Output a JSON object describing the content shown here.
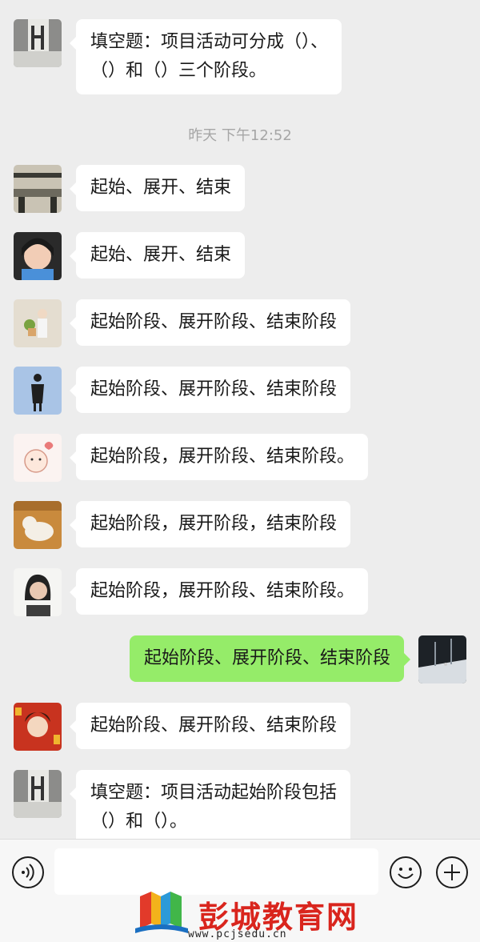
{
  "chat": {
    "timestamp": "昨天 下午12:52",
    "messages": [
      {
        "side": "left",
        "avatar": "avatar-statue",
        "text": "填空题：项目活动可分成（）、\n（）和（）三个阶段。"
      },
      {
        "side": "left",
        "avatar": "avatar-building",
        "text": "起始、展开、结束"
      },
      {
        "side": "left",
        "avatar": "avatar-girl",
        "text": "起始、展开、结束"
      },
      {
        "side": "left",
        "avatar": "avatar-illustration-plant",
        "text": "起始阶段、展开阶段、结束阶段"
      },
      {
        "side": "left",
        "avatar": "avatar-illustration-figure",
        "text": "起始阶段、展开阶段、结束阶段"
      },
      {
        "side": "left",
        "avatar": "avatar-cartoon-baby",
        "text": "起始阶段，展开阶段、结束阶段。"
      },
      {
        "side": "left",
        "avatar": "avatar-cat",
        "text": "起始阶段，展开阶段，结束阶段"
      },
      {
        "side": "left",
        "avatar": "avatar-woman",
        "text": "起始阶段，展开阶段、结束阶段。"
      },
      {
        "side": "right",
        "avatar": "avatar-snow-scene",
        "text": "起始阶段、展开阶段、结束阶段"
      },
      {
        "side": "left",
        "avatar": "avatar-red-art",
        "text": "起始阶段、展开阶段、结束阶段"
      },
      {
        "side": "left",
        "avatar": "avatar-statue",
        "text": "填空题：项目活动起始阶段包括\n（）和（）。"
      }
    ]
  },
  "input_bar": {
    "voice_icon": "voice-icon",
    "emoji_icon": "emoji-icon",
    "plus_icon": "plus-icon",
    "input_value": ""
  },
  "watermark": {
    "brand": "彭城教育网",
    "url": "www.pcjsedu.cn"
  },
  "colors": {
    "background": "#ededed",
    "incoming_bubble": "#ffffff",
    "outgoing_bubble": "#95ec69",
    "timestamp": "#a6a6a6",
    "watermark_red": "#d9251d"
  }
}
